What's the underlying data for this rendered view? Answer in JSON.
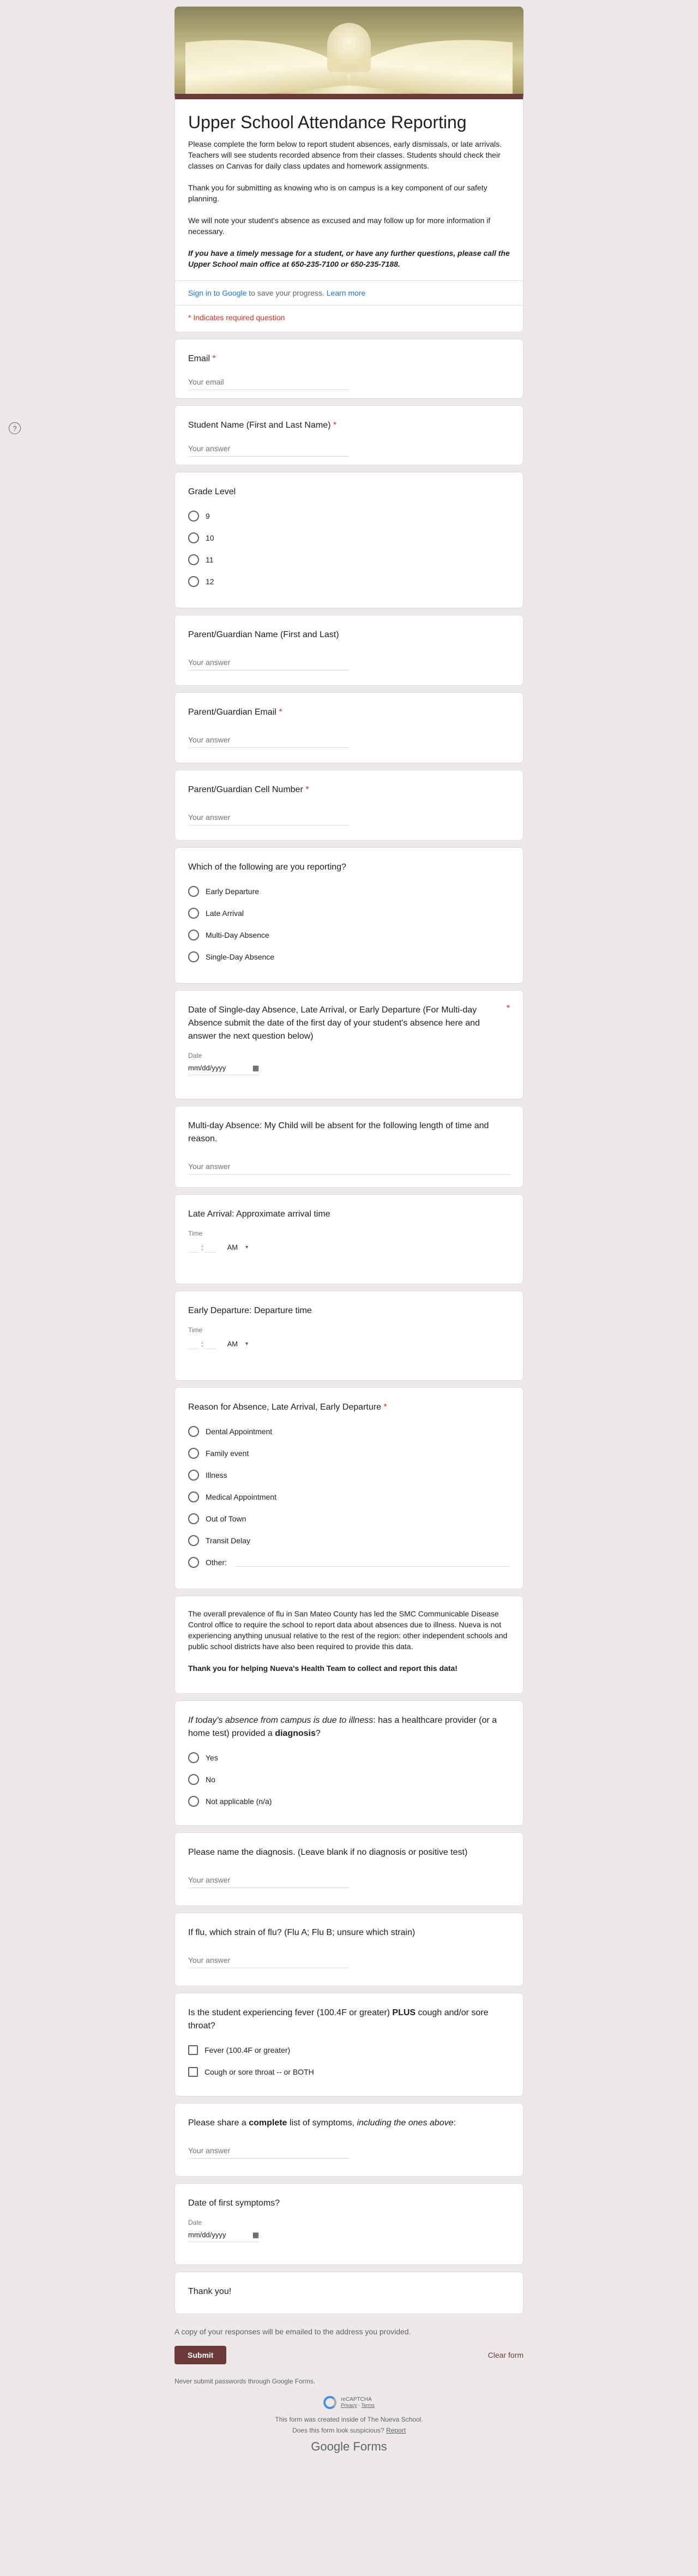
{
  "form": {
    "title": "Upper School Attendance Reporting",
    "description": [
      "Please complete the form below to report student absences, early dismissals, or late arrivals. Teachers will see students recorded absence from their classes. Students should check their classes on Canvas for daily class updates and homework assignments.",
      "Thank you for submitting as knowing who is on campus is a key component of our safety planning.",
      "We will note your student's absence as excused and may follow up for more information if necessary."
    ],
    "description_bold": "If you have a timely message for a student, or have any further questions, please call the Upper School main office at 650-235-7100 or 650-235-7188.",
    "signin_link": "Sign in to Google",
    "signin_text": " to save your progress. ",
    "learn_more": "Learn more",
    "required_note": "* Indicates required question"
  },
  "questions": {
    "email": {
      "title": "Email",
      "star": "*",
      "placeholder": "Your email"
    },
    "student_name": {
      "title": "Student Name (First and Last Name)",
      "star": "*",
      "placeholder": "Your answer"
    },
    "grade": {
      "title": "Grade Level",
      "options": [
        "9",
        "10",
        "11",
        "12"
      ]
    },
    "parent_name": {
      "title": "Parent/Guardian Name (First and Last)",
      "placeholder": "Your answer"
    },
    "parent_email": {
      "title": "Parent/Guardian Email",
      "star": "*",
      "placeholder": "Your answer"
    },
    "parent_cell": {
      "title": "Parent/Guardian Cell Number",
      "star": "*",
      "placeholder": "Your answer"
    },
    "reporting": {
      "title": "Which of the following are you reporting?",
      "options": [
        "Early Departure",
        "Late Arrival",
        "Multi-Day Absence",
        "Single-Day Absence"
      ]
    },
    "date_single": {
      "title": "Date of Single-day Absence, Late Arrival, or Early Departure (For Multi-day Absence submit the date of the first day of your student's absence here and answer the next question below)",
      "star": "*",
      "label": "Date",
      "value": "mm/dd/yyyy"
    },
    "multi_day": {
      "title": "Multi-day Absence: My Child will be absent for the following length of time and reason.",
      "placeholder": "Your answer"
    },
    "late_arrival": {
      "title": "Late Arrival: Approximate arrival time",
      "label": "Time",
      "ampm": "AM"
    },
    "early_departure": {
      "title": "Early Departure: Departure time",
      "label": "Time",
      "ampm": "AM"
    },
    "reason": {
      "title": "Reason for Absence, Late Arrival, Early Departure",
      "star": "*",
      "options": [
        "Dental Appointment",
        "Family event",
        "Illness",
        "Medical Appointment",
        "Out of Town",
        "Transit Delay",
        "Other:"
      ]
    },
    "info": {
      "text": "The overall prevalence of flu in San Mateo County has led the SMC Communicable Disease Control office to require the school to report data about absences due to illness. Nueva is not experiencing anything unusual relative to the rest of the region: other independent schools and public school districts have also been required to provide this data.",
      "bold": "Thank you for helping Nueva's Health Team to collect and report this data!"
    },
    "illness": {
      "title_italic": "If today's absence from campus is due to illness",
      "title_mid": ": has a healthcare provider (or a home test) provided a ",
      "title_bold": "diagnosis",
      "title_end": "?",
      "options": [
        "Yes",
        "No",
        "Not applicable (n/a)"
      ]
    },
    "diagnosis": {
      "title": "Please name the diagnosis. (Leave blank if no diagnosis or positive test)",
      "placeholder": "Your answer"
    },
    "flu_strain": {
      "title": "If flu, which strain of flu? (Flu A; Flu B; unsure which strain)",
      "placeholder": "Your answer"
    },
    "fever": {
      "title_a": "Is the student experiencing fever (100.4F or greater) ",
      "title_bold": "PLUS",
      "title_b": " cough and/or sore throat?",
      "options": [
        "Fever (100.4F or greater)",
        "Cough or sore throat -- or BOTH"
      ]
    },
    "symptoms": {
      "title_a": "Please share a ",
      "title_bold": "complete",
      "title_b": " list of symptoms, ",
      "title_italic": "including the ones above",
      "title_end": ":",
      "placeholder": "Your answer"
    },
    "first_symptoms": {
      "title": "Date of first symptoms?",
      "label": "Date",
      "value": "mm/dd/yyyy"
    },
    "thanks": {
      "title": "Thank you!"
    }
  },
  "footer": {
    "copy_note": "A copy of your responses will be emailed to the address you provided.",
    "submit": "Submit",
    "clear": "Clear form",
    "never": "Never submit passwords through Google Forms.",
    "recaptcha": "reCAPTCHA",
    "privacy": "Privacy",
    "terms": "Terms",
    "created": "This form was created inside of The Nueva School.",
    "suspicious": "Does this form look suspicious?",
    "report": "Report",
    "brand": "Google Forms"
  },
  "colors": {
    "theme": "#6d3a3a",
    "background": "#eee9e9",
    "required": "#d93025",
    "link": "#1a73e8"
  },
  "icons": {
    "help": "help-circle-icon",
    "calendar": "calendar-icon"
  }
}
